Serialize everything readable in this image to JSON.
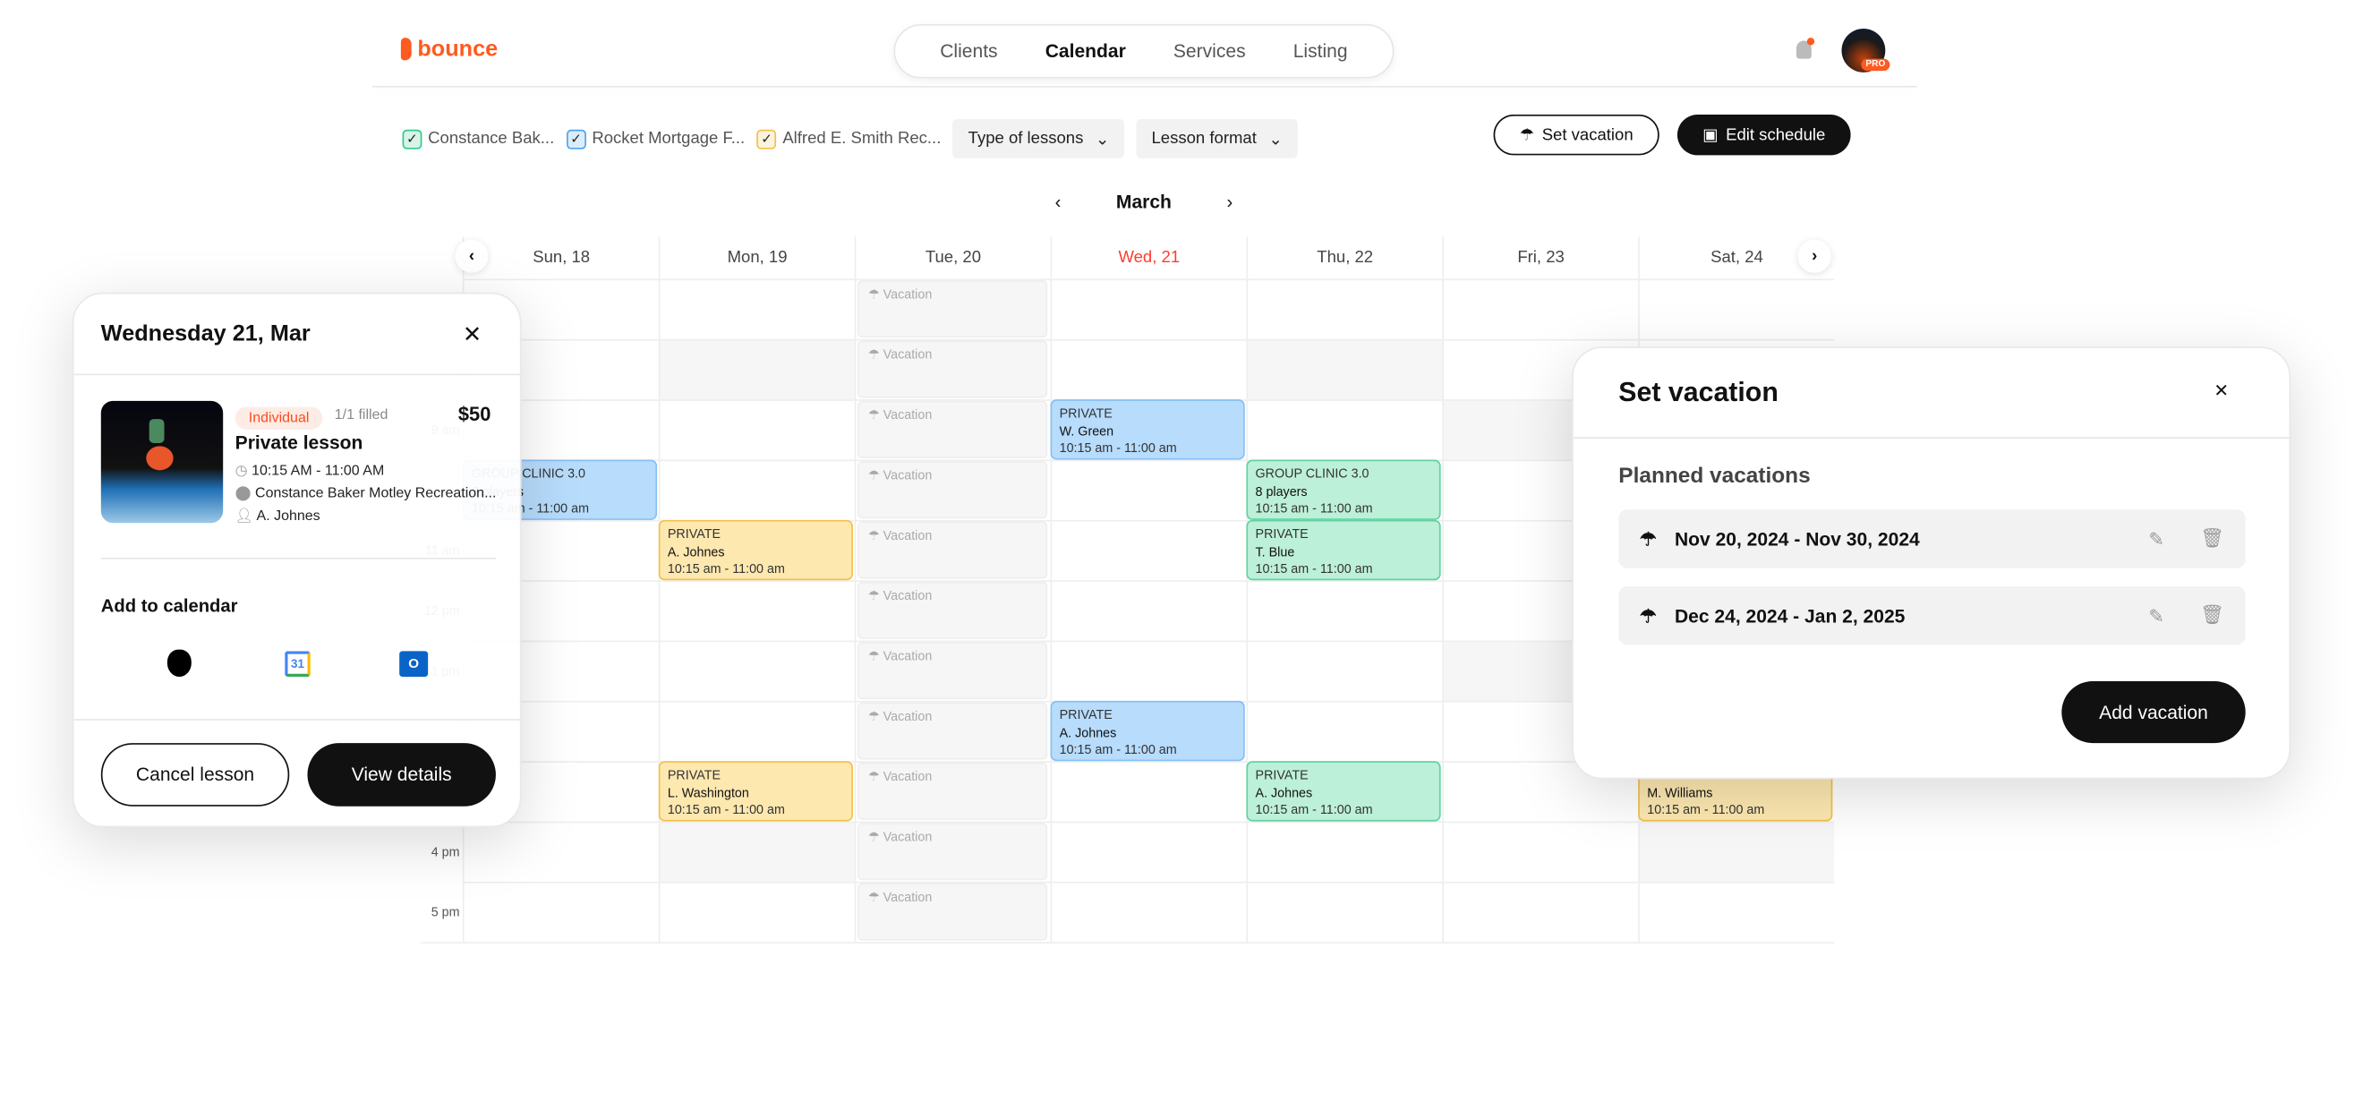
{
  "brand": {
    "name": "bounce",
    "accent": "#ff5a1f"
  },
  "nav": {
    "items": [
      "Clients",
      "Calendar",
      "Services",
      "Listing"
    ],
    "active": 1
  },
  "user": {
    "badge": "PRO"
  },
  "filters": {
    "locations": [
      {
        "label": "Constance Bak...",
        "color": "#34c98a"
      },
      {
        "label": "Rocket Mortgage F...",
        "color": "#4da3f0"
      },
      {
        "label": "Alfred E. Smith Rec...",
        "color": "#f2c14e"
      }
    ],
    "dropdowns": [
      "Type of lessons",
      "Lesson format"
    ]
  },
  "actions": {
    "set_vacation": "Set vacation",
    "edit_schedule": "Edit schedule"
  },
  "calendar": {
    "month": "March",
    "days": [
      "Sun, 18",
      "Mon, 19",
      "Tue, 20",
      "Wed, 21",
      "Thu, 22",
      "Fri, 23",
      "Sat, 24"
    ],
    "today_index": 3,
    "today_color": "#ff3b30",
    "hours": [
      "",
      "",
      "9 am",
      "",
      "11 am",
      "12 pm",
      "1 pm",
      "",
      "",
      "4 pm",
      "5 pm"
    ],
    "vacation_label": "Vacation",
    "vacation_day": 2,
    "gray_cells": [
      [
        1,
        1
      ],
      [
        1,
        9
      ],
      [
        4,
        1
      ],
      [
        5,
        2
      ],
      [
        5,
        6
      ],
      [
        6,
        9
      ]
    ],
    "colors": {
      "blue": {
        "bg": "#b7dcfc",
        "border": "#86c0f5"
      },
      "yellow": {
        "bg": "#fde8b0",
        "border": "#f2c14e"
      },
      "green": {
        "bg": "#bdf0d8",
        "border": "#5fd3a0"
      }
    },
    "events": [
      {
        "day": 0,
        "row": 3,
        "color": "blue",
        "type": "GROUP CLINIC 3.0",
        "name": "8 players",
        "time": "10:15 am - 11:00 am"
      },
      {
        "day": 1,
        "row": 4,
        "color": "yellow",
        "type": "PRIVATE",
        "name": "A. Johnes",
        "time": "10:15 am - 11:00 am"
      },
      {
        "day": 1,
        "row": 8,
        "color": "yellow",
        "type": "PRIVATE",
        "name": "L. Washington",
        "time": "10:15 am - 11:00 am"
      },
      {
        "day": 3,
        "row": 2,
        "color": "blue",
        "type": "PRIVATE",
        "name": "W. Green",
        "time": "10:15 am - 11:00 am"
      },
      {
        "day": 3,
        "row": 7,
        "color": "blue",
        "type": "PRIVATE",
        "name": "A. Johnes",
        "time": "10:15 am - 11:00 am"
      },
      {
        "day": 4,
        "row": 3,
        "color": "green",
        "type": "GROUP CLINIC 3.0",
        "name": "8 players",
        "time": "10:15 am - 11:00 am"
      },
      {
        "day": 4,
        "row": 4,
        "color": "green",
        "type": "PRIVATE",
        "name": "T. Blue",
        "time": "10:15 am - 11:00 am"
      },
      {
        "day": 4,
        "row": 8,
        "color": "green",
        "type": "PRIVATE",
        "name": "A. Johnes",
        "time": "10:15 am - 11:00 am"
      },
      {
        "day": 6,
        "row": 8,
        "color": "yellow",
        "type": "PRIVATE",
        "name": "M. Williams",
        "time": "10:15 am - 11:00 am"
      }
    ]
  },
  "lesson_popup": {
    "title": "Wednesday 21, Mar",
    "tag": "Individual",
    "filled": "1/1 filled",
    "price": "$50",
    "name": "Private lesson",
    "time": "10:15 AM - 11:00 AM",
    "location": "Constance Baker Motley Recreation...",
    "coach": "A. Johnes",
    "add_to_calendar": "Add to calendar",
    "calendar_apps": [
      "apple-icon",
      "google-calendar-icon",
      "outlook-icon"
    ],
    "cancel": "Cancel lesson",
    "view": "View details"
  },
  "vacation_popup": {
    "title": "Set vacation",
    "subtitle": "Planned vacations",
    "vacations": [
      "Nov 20, 2024 - Nov 30, 2024",
      "Dec 24, 2024 - Jan 2, 2025"
    ],
    "add": "Add vacation"
  }
}
